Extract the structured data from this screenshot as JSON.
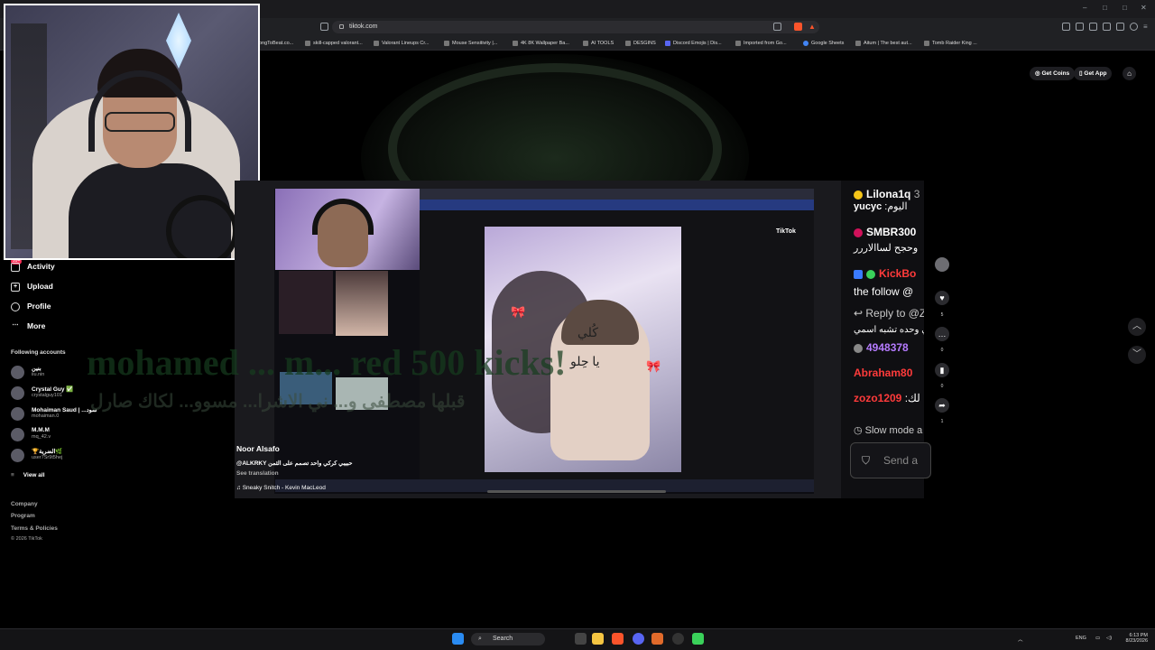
{
  "browser": {
    "url": "tiktok.com",
    "bookmarks": [
      "ongToBeat.co...",
      "skill-capped valorant...",
      "Valorant Lineups Cr...",
      "Mouse Sensitivity |...",
      "4K 8K Wallpaper Ba...",
      "AI TOOLS",
      "DESGINS",
      "Discord Emojis | Dis...",
      "Imported from Go...",
      "Google Sheets",
      "Aitum | The best aut...",
      "Tomb Raider King ..."
    ]
  },
  "header": {
    "get_coins": "Get Coins",
    "get_app": "Get App"
  },
  "sidebar": {
    "badge": "99+",
    "items": [
      {
        "label": "Activity",
        "icon": "bell-icon"
      },
      {
        "label": "Upload",
        "icon": "plus-square-icon"
      },
      {
        "label": "Profile",
        "icon": "user-icon"
      },
      {
        "label": "More",
        "icon": "dots-icon"
      }
    ],
    "following_title": "Following accounts",
    "accounts": [
      {
        "name": "بنين",
        "handle": "iiu.nin"
      },
      {
        "name": "Crystal Guy ✅",
        "handle": "crystalguy101"
      },
      {
        "name": "Mohaiman Saud | ...سود",
        "handle": "mohaiman.0"
      },
      {
        "name": "M.M.M",
        "handle": "mq_42.v"
      },
      {
        "name": "🏆الضرية🌿",
        "handle": "user7Sr9t5hej"
      }
    ],
    "view_all": "View all",
    "footer": [
      "Company",
      "Program",
      "Terms & Policies",
      "© 2026 TikTok"
    ]
  },
  "video": {
    "author": "Noor Alsafo",
    "caption_handle": "@ALKRKY",
    "caption_text": "حبيبي كركي واحد تصمم على الثمن",
    "see_translation": "See translation",
    "music": "Sneaky Snitch - Kevin MacLeod",
    "overlay_title": "mohamed ... m... red 500 kicks!",
    "overlay_arabic": "قبلها مصطفى و... ني الاشرا... مسوو... لكاك صارل",
    "inner_tiktok": "TikTok",
    "inner_video_text1": "كُلي",
    "inner_video_text2": "يا حِلو"
  },
  "chat": {
    "messages": [
      {
        "user": "Lilona1q",
        "text": "3",
        "color": "#ffffff"
      },
      {
        "user": "yucyc",
        "text": ":اليوم",
        "color": "#ffffff"
      },
      {
        "user": "SMBR300",
        "text": "",
        "color": "#ffffff"
      },
      {
        "user": "",
        "text": "وحجح لساالاررر",
        "color": "#ffffff"
      },
      {
        "user": "KickBo",
        "text": "",
        "color": "#ff3b3b"
      },
      {
        "user": "",
        "text": "the follow @",
        "color": "#ffffff"
      },
      {
        "user": "",
        "text": "↩ Reply to @Z",
        "color": "#ffffff"
      },
      {
        "user": "",
        "text": "ي وحده تشبه اسمي",
        "color": "#ffffff"
      },
      {
        "user": "4948378",
        "text": "",
        "color": "#b57bff"
      },
      {
        "user": "Abraham80",
        "text": "",
        "color": "#ff3b3b"
      },
      {
        "user": "zozo1209",
        "text": ":لك",
        "color": "#ff3b3b"
      }
    ],
    "slow_mode": "Slow mode a",
    "send_placeholder": "Send a"
  },
  "actions": [
    {
      "icon": "heart-icon",
      "count": "5"
    },
    {
      "icon": "comment-icon",
      "count": "0"
    },
    {
      "icon": "bookmark-icon",
      "count": "0"
    },
    {
      "icon": "share-icon",
      "count": "1"
    }
  ],
  "taskbar": {
    "search": "Search",
    "lang": "ENG",
    "time": "6:13 PM",
    "date": "8/23/2026"
  }
}
